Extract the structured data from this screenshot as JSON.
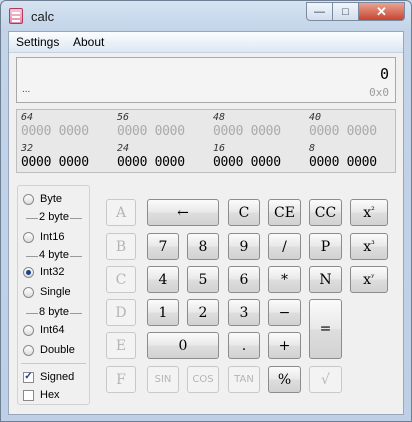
{
  "window": {
    "title": "calc",
    "min_label": "—",
    "max_label": "□",
    "close_label": "✕"
  },
  "menu": {
    "settings": "Settings",
    "about": "About"
  },
  "display": {
    "value": "0",
    "ellipsis": "...",
    "hex": "0x0"
  },
  "bits": {
    "labels": [
      "64",
      "56",
      "48",
      "40",
      "32",
      "24",
      "16",
      "8"
    ],
    "groups": [
      "0000 0000",
      "0000 0000",
      "0000 0000",
      "0000 0000",
      "0000 0000",
      "0000 0000",
      "0000 0000",
      "0000 0000"
    ]
  },
  "word_size": {
    "byte": "Byte",
    "sep2": "2 byte",
    "int16": "Int16",
    "sep4": "4 byte",
    "int32": "Int32",
    "single": "Single",
    "sep8": "8 byte",
    "int64": "Int64",
    "double": "Double",
    "selected": "Int32"
  },
  "options": {
    "signed": "Signed",
    "signed_checked": true,
    "hex": "Hex",
    "hex_checked": false
  },
  "keys": {
    "hex_a": "A",
    "hex_b": "B",
    "hex_c": "C",
    "hex_d": "D",
    "hex_e": "E",
    "hex_f": "F",
    "backspace": "←",
    "clear": "C",
    "clear_entry": "CE",
    "cc": "CC",
    "seven": "7",
    "eight": "8",
    "nine": "9",
    "divide": "/",
    "p": "P",
    "four": "4",
    "five": "5",
    "six": "6",
    "multiply": "*",
    "n": "N",
    "one": "1",
    "two": "2",
    "three": "3",
    "minus": "−",
    "equals": "=",
    "zero": "0",
    "decimal": ".",
    "plus": "+",
    "sin": "SIN",
    "cos": "COS",
    "tan": "TAN",
    "percent": "%",
    "sqrt": "√",
    "pow_base": "x",
    "square_exp": "²",
    "cube_exp": "³",
    "power_exp": "ʸ"
  }
}
